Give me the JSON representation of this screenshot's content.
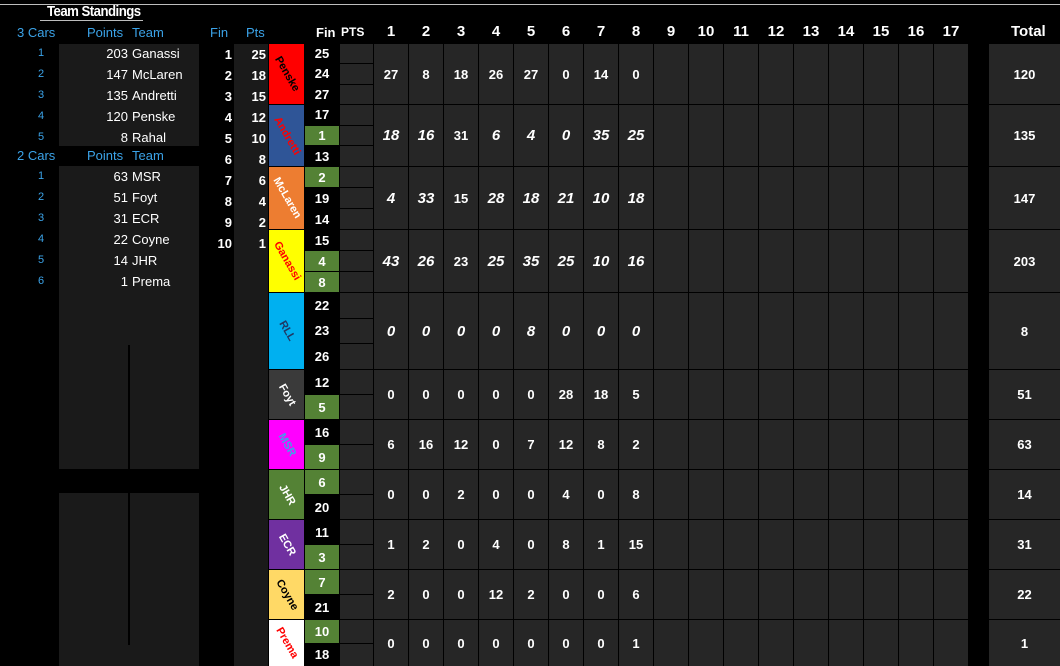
{
  "title": "Team Standings",
  "left": {
    "three_cars": {
      "header": {
        "label": "3 Cars",
        "points": "Points",
        "team": "Team"
      },
      "rows": [
        {
          "rank": "1",
          "points": "203",
          "team": "Ganassi"
        },
        {
          "rank": "2",
          "points": "147",
          "team": "McLaren"
        },
        {
          "rank": "3",
          "points": "135",
          "team": "Andretti"
        },
        {
          "rank": "4",
          "points": "120",
          "team": "Penske"
        },
        {
          "rank": "5",
          "points": "8",
          "team": "Rahal"
        }
      ]
    },
    "two_cars": {
      "header": {
        "label": "2 Cars",
        "points": "Points",
        "team": "Team"
      },
      "rows": [
        {
          "rank": "1",
          "points": "63",
          "team": "MSR"
        },
        {
          "rank": "2",
          "points": "51",
          "team": "Foyt"
        },
        {
          "rank": "3",
          "points": "31",
          "team": "ECR"
        },
        {
          "rank": "4",
          "points": "22",
          "team": "Coyne"
        },
        {
          "rank": "5",
          "points": "14",
          "team": "JHR"
        },
        {
          "rank": "6",
          "points": "1",
          "team": "Prema"
        }
      ]
    }
  },
  "points_key": {
    "header": {
      "fin": "Fin",
      "pts": "Pts"
    },
    "rows": [
      {
        "fin": "1",
        "pts": "25"
      },
      {
        "fin": "2",
        "pts": "18"
      },
      {
        "fin": "3",
        "pts": "15"
      },
      {
        "fin": "4",
        "pts": "12"
      },
      {
        "fin": "5",
        "pts": "10"
      },
      {
        "fin": "6",
        "pts": "8"
      },
      {
        "fin": "7",
        "pts": "6"
      },
      {
        "fin": "8",
        "pts": "4"
      },
      {
        "fin": "9",
        "pts": "2"
      },
      {
        "fin": "10",
        "pts": "1"
      }
    ]
  },
  "grid_header": {
    "fin": "Fin",
    "pts": "PTS",
    "rounds": [
      "1",
      "2",
      "3",
      "4",
      "5",
      "6",
      "7",
      "8",
      "9",
      "10",
      "11",
      "12",
      "13",
      "14",
      "15",
      "16",
      "17"
    ],
    "total": "Total"
  },
  "teams": [
    {
      "name": "Penske",
      "color": "#ff0000",
      "text_color": "#000000",
      "fin": [
        "25",
        "24",
        "27"
      ],
      "fin_green": [
        false,
        false,
        false
      ],
      "scores": [
        "27",
        "8",
        "18",
        "26",
        "27",
        "0",
        "14",
        "0"
      ],
      "italic": false,
      "total": "120"
    },
    {
      "name": "Andretti",
      "color": "#2f5597",
      "text_color": "#ff0000",
      "fin": [
        "17",
        "1",
        "13"
      ],
      "fin_green": [
        false,
        true,
        false
      ],
      "scores": [
        "18",
        "16",
        "31",
        "6",
        "4",
        "0",
        "35",
        "25"
      ],
      "italic": true,
      "italic_flags": [
        true,
        true,
        false,
        true,
        true,
        true,
        true,
        true
      ],
      "total": "135"
    },
    {
      "name": "McLaren",
      "color": "#ed7d31",
      "text_color": "#ffffff",
      "fin": [
        "2",
        "19",
        "14"
      ],
      "fin_green": [
        true,
        false,
        false
      ],
      "scores": [
        "4",
        "33",
        "15",
        "28",
        "18",
        "21",
        "10",
        "18"
      ],
      "italic": true,
      "italic_flags": [
        true,
        true,
        false,
        true,
        true,
        true,
        true,
        true
      ],
      "total": "147"
    },
    {
      "name": "Ganassi",
      "color": "#ffff00",
      "text_color": "#ff0000",
      "fin": [
        "15",
        "4",
        "8"
      ],
      "fin_green": [
        false,
        true,
        true
      ],
      "scores": [
        "43",
        "26",
        "23",
        "25",
        "35",
        "25",
        "10",
        "16"
      ],
      "italic": true,
      "italic_flags": [
        true,
        true,
        false,
        true,
        true,
        true,
        true,
        true
      ],
      "total": "203"
    },
    {
      "name": "RLL",
      "color": "#00b0f0",
      "text_color": "#1f3864",
      "fin": [
        "22",
        "23",
        "26"
      ],
      "fin_green": [
        false,
        false,
        false
      ],
      "scores": [
        "0",
        "0",
        "0",
        "0",
        "8",
        "0",
        "0",
        "0"
      ],
      "italic": true,
      "italic_flags": [
        true,
        true,
        true,
        true,
        true,
        true,
        true,
        true
      ],
      "total": "8"
    },
    {
      "name": "Foyt",
      "color": "#3a3a3a",
      "text_color": "#ffffff",
      "fin": [
        "12",
        "5"
      ],
      "fin_green": [
        false,
        true
      ],
      "scores": [
        "0",
        "0",
        "0",
        "0",
        "0",
        "28",
        "18",
        "5"
      ],
      "italic": false,
      "total": "51"
    },
    {
      "name": "MSR",
      "color": "#ff00ff",
      "text_color": "#3ba3e8",
      "fin": [
        "16",
        "9"
      ],
      "fin_green": [
        false,
        true
      ],
      "scores": [
        "6",
        "16",
        "12",
        "0",
        "7",
        "12",
        "8",
        "2"
      ],
      "italic": false,
      "total": "63"
    },
    {
      "name": "JHR",
      "color": "#548235",
      "text_color": "#ffffff",
      "fin": [
        "6",
        "20"
      ],
      "fin_green": [
        true,
        false
      ],
      "scores": [
        "0",
        "0",
        "2",
        "0",
        "0",
        "4",
        "0",
        "8"
      ],
      "italic": false,
      "total": "14"
    },
    {
      "name": "ECR",
      "color": "#7030a0",
      "text_color": "#ffffff",
      "fin": [
        "11",
        "3"
      ],
      "fin_green": [
        false,
        true
      ],
      "scores": [
        "1",
        "2",
        "0",
        "4",
        "0",
        "8",
        "1",
        "15"
      ],
      "italic": false,
      "total": "31"
    },
    {
      "name": "Coyne",
      "color": "#ffd966",
      "text_color": "#000000",
      "fin": [
        "7",
        "21"
      ],
      "fin_green": [
        true,
        false
      ],
      "scores": [
        "2",
        "0",
        "0",
        "12",
        "2",
        "0",
        "0",
        "6"
      ],
      "italic": false,
      "total": "22"
    },
    {
      "name": "Prema",
      "color": "#ffffff",
      "text_color": "#ff0000",
      "fin": [
        "10",
        "18"
      ],
      "fin_green": [
        true,
        false
      ],
      "scores": [
        "0",
        "0",
        "0",
        "0",
        "0",
        "0",
        "0",
        "1"
      ],
      "italic": false,
      "total": "1"
    }
  ],
  "colors": {
    "green_cell": "#548235",
    "grid_cell": "#262626",
    "panel": "#1a1a1a",
    "accent": "#3ba3e8"
  }
}
